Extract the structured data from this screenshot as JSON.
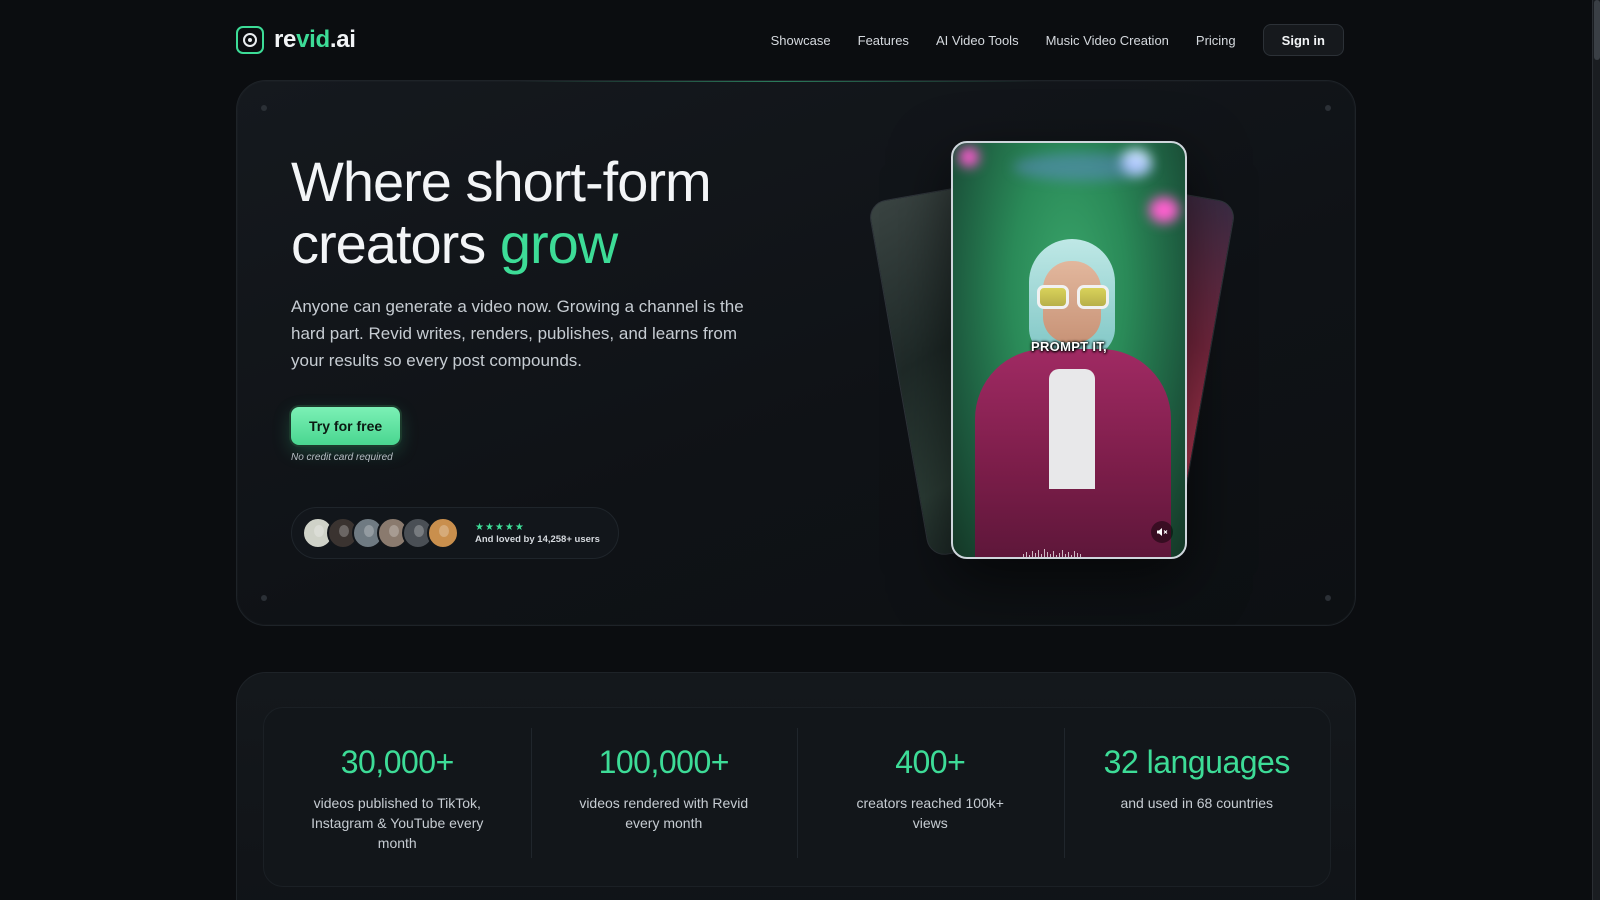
{
  "nav": {
    "logo_pre": "re",
    "logo_accent": "vid",
    "logo_post": ".ai",
    "links": [
      "Showcase",
      "Features",
      "AI Video Tools",
      "Music Video Creation",
      "Pricing"
    ],
    "signin_label": "Sign in"
  },
  "hero": {
    "headline_line1": "Where short-form",
    "headline_line2_pre": "creators ",
    "headline_accent": "grow",
    "subtext": "Anyone can generate a video now. Growing a channel is the hard part. Revid writes, renders, publishes, and learns from your results so every post compounds.",
    "cta_label": "Try for free",
    "cta_note": "No credit card required",
    "social": {
      "stars": "★★★★★",
      "text": "And loved by 14,258+ users",
      "avatar_count": 6
    },
    "video_caption": "PROMPT IT,",
    "mute_icon": "volume-mute-icon"
  },
  "stats": [
    {
      "value": "30,000+",
      "desc": "videos published to TikTok, Instagram & YouTube every month"
    },
    {
      "value": "100,000+",
      "desc": "videos rendered with Revid every month"
    },
    {
      "value": "400+",
      "desc": "creators reached 100k+ views"
    },
    {
      "value": "32 languages",
      "desc": "and used in 68 countries"
    }
  ],
  "colors": {
    "background": "#0b0d10",
    "accent": "#3ddc97",
    "card": "#12161a",
    "text": "#e9ecef"
  }
}
